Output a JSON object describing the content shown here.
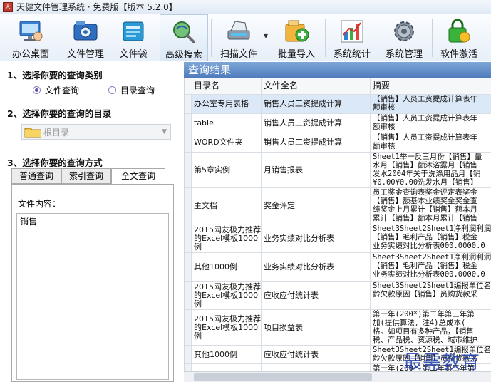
{
  "window": {
    "title": "天健文件管理系统 · 免费版【版本 5.2.0】"
  },
  "toolbar": {
    "buttons": [
      {
        "label": "办公桌面",
        "icon": "desktop-computer-icon"
      },
      {
        "label": "文件管理",
        "icon": "file-manager-icon"
      },
      {
        "label": "文件袋",
        "icon": "file-bag-icon"
      },
      {
        "label": "高级搜索",
        "icon": "magnifier-globe-icon"
      },
      {
        "label": "扫描文件",
        "icon": "scanner-icon"
      },
      {
        "label": "批量导入",
        "icon": "batch-import-icon"
      },
      {
        "label": "系统统计",
        "icon": "statistics-chart-icon"
      },
      {
        "label": "系统管理",
        "icon": "system-gear-icon"
      },
      {
        "label": "软件激活",
        "icon": "lock-activation-icon"
      }
    ]
  },
  "left": {
    "section1": "1、选择你要的查询类别",
    "type_options": [
      {
        "label": "文件查询",
        "checked": true
      },
      {
        "label": "目录查询",
        "checked": false
      }
    ],
    "section2": "2、选择你要的查询的目录",
    "dir_value": "根目录",
    "section3": "3、选择你要的查询方式",
    "tabs": [
      {
        "label": "普通查询",
        "active": false
      },
      {
        "label": "索引查询",
        "active": false
      },
      {
        "label": "全文查询",
        "active": true
      }
    ],
    "content_label": "文件内容：",
    "content_value": "销售"
  },
  "results": {
    "title": "查询结果",
    "columns": [
      "目录名",
      "文件全名",
      "摘要"
    ],
    "rows": [
      {
        "dir": "办公室专用表格",
        "file": "销售人员工资提成计算",
        "summary": "【销售】人员工资提成计算表年\n额审核                        "
      },
      {
        "dir": "table",
        "file": "销售人员工资提成计算",
        "summary": "【销售】人员工资提成计算表年\n额审核"
      },
      {
        "dir": "WORD文件夹",
        "file": "销售人员工资提成计算",
        "summary": "【销售】人员工资提成计算表年\n额审核"
      },
      {
        "dir": "第5章实例",
        "file": "月销售报表",
        "summary": "Sheet1举一反三月份【销售】量\n水月【销售】额沐浴露月【销售\n发水2004年关于洗涤用品月【销\n¥0.00¥0.00洗发水月【销售】"
      },
      {
        "dir": "主文档",
        "file": "奖金评定",
        "summary": "员工奖金查询表奖金评定表奖金\n【销售】额基本业绩奖金奖金查\n绩奖金上月累计【销售】额本月\n累计【销售】额本月累计【销售"
      },
      {
        "dir": "2015网友极力推荐的Excel模板1000例",
        "file": "业务实绩对比分析表",
        "summary": "Sheet3Sheet2Sheet1净利润利润\n【销售】毛利产品【销售】税金\n业务实绩对比分析表000.0000.0"
      },
      {
        "dir": "其他1000例",
        "file": "业务实绩对比分析表",
        "summary": "Sheet3Sheet2Sheet1净利润利润\n【销售】毛利产品【销售】税金\n业务实绩对比分析表000.0000.0"
      },
      {
        "dir": "2015网友极力推荐的Excel模板1000例",
        "file": "应收应付统计表",
        "summary": "Sheet3Sheet2Sheet1编报单位名\n龄欠款原因【销售】员购货款采"
      },
      {
        "dir": "2015网友极力推荐的Excel模板1000例",
        "file": "项目损益表",
        "summary": "第一年(200*)第二年第三年第\n加(提供算法，注4)总成本(\n格。如项目有多种产品，【销售\n税、产品税、资源税、城市维护"
      },
      {
        "dir": "其他1000例",
        "file": "应收应付统计表",
        "summary": "Sheet3Sheet2Sheet1编报单位名\n龄欠款原因【销售】员购货款采"
      },
      {
        "dir": "",
        "file": "",
        "summary": "第一年(200*)第二年第三年第"
      }
    ]
  },
  "watermark": "最需教育"
}
